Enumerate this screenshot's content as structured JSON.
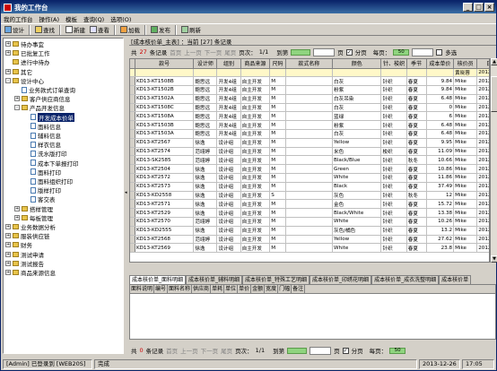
{
  "window": {
    "title": "我的工作台"
  },
  "menu": [
    "我的工作台",
    "操作(A)",
    "模板",
    "查询(Q)",
    "选项(O)"
  ],
  "toolbar": [
    "设计",
    "查找",
    "新建",
    "查看",
    "加载",
    "发布",
    "刷新"
  ],
  "tree": [
    {
      "label": "待办事宜",
      "level": 0,
      "exp": "+",
      "icon": "folder"
    },
    {
      "label": "已批复工作",
      "level": 0,
      "exp": "+",
      "icon": "folder"
    },
    {
      "label": "进行中待办",
      "level": 0,
      "exp": "",
      "icon": "folder"
    },
    {
      "label": "其它",
      "level": 0,
      "exp": "+",
      "icon": "folder"
    },
    {
      "label": "设计中心",
      "level": 0,
      "exp": "-",
      "icon": "folder"
    },
    {
      "label": "业务款式订单查询",
      "level": 1,
      "exp": "",
      "icon": "doc"
    },
    {
      "label": "客户供应商信息",
      "level": 1,
      "exp": "+",
      "icon": "folder"
    },
    {
      "label": "产品开发信息",
      "level": 1,
      "exp": "-",
      "icon": "folder"
    },
    {
      "label": "开发成本价单",
      "level": 2,
      "exp": "",
      "icon": "doc",
      "selected": true
    },
    {
      "label": "面料信息",
      "level": 2,
      "exp": "",
      "icon": "doc"
    },
    {
      "label": "辅料信息",
      "level": 2,
      "exp": "",
      "icon": "doc"
    },
    {
      "label": "样衣信息",
      "level": 2,
      "exp": "",
      "icon": "doc"
    },
    {
      "label": "洗水版打印",
      "level": 2,
      "exp": "",
      "icon": "doc"
    },
    {
      "label": "成本下单报打印",
      "level": 2,
      "exp": "",
      "icon": "doc"
    },
    {
      "label": "面料打印",
      "level": 2,
      "exp": "",
      "icon": "doc"
    },
    {
      "label": "面料组织打印",
      "level": 2,
      "exp": "",
      "icon": "doc"
    },
    {
      "label": "版样打印",
      "level": 2,
      "exp": "",
      "icon": "doc"
    },
    {
      "label": "客交表",
      "level": 2,
      "exp": "",
      "icon": "doc"
    },
    {
      "label": "搭样管理",
      "level": 1,
      "exp": "+",
      "icon": "folder"
    },
    {
      "label": "每板管理",
      "level": 1,
      "exp": "+",
      "icon": "folder"
    },
    {
      "label": "业务数据分析",
      "level": 0,
      "exp": "+",
      "icon": "folder"
    },
    {
      "label": "服装供应链",
      "level": 0,
      "exp": "+",
      "icon": "folder"
    },
    {
      "label": "财务",
      "level": 0,
      "exp": "+",
      "icon": "folder"
    },
    {
      "label": "测试申请",
      "level": 0,
      "exp": "+",
      "icon": "folder"
    },
    {
      "label": "测试报告",
      "level": 0,
      "exp": "+",
      "icon": "folder"
    },
    {
      "label": "商品来源信息",
      "level": 0,
      "exp": "+",
      "icon": "folder"
    }
  ],
  "main": {
    "header": "[成本核价单_主表] ：当前 [27] 条记录",
    "nav_top": {
      "total_label": "共",
      "total": "27",
      "unit": "条记录",
      "first": "首页",
      "prev": "上一页",
      "next": "下一页",
      "last": "尾页",
      "page_label": "页次：",
      "page": "1/1",
      "goto": "到第",
      "page_unit": "页",
      "paging": "分页",
      "per_page": "每页：",
      "per_page_value": "50",
      "multi": "多选"
    },
    "nav_bottom": {
      "total_label": "共",
      "total": "0",
      "unit": "条记录",
      "first": "首页",
      "prev": "上一页",
      "next": "下一页",
      "last": "尾页",
      "page_label": "页次：",
      "page": "1/1",
      "goto": "到第",
      "page_unit": "页",
      "paging": "分页",
      "per_page": "每页：",
      "per_page_value": "50"
    }
  },
  "grid": {
    "columns": [
      "款号",
      "设计师",
      "组别",
      "商品来源",
      "尺码",
      "款式名称",
      "颜色",
      "针、梭织",
      "季节",
      "成本单价",
      "核价员",
      "日期"
    ],
    "rows": [
      [
        "",
        "",
        "",
        "",
        "",
        "",
        "",
        "",
        "",
        "",
        "黄晓蓉",
        "2012-8-3"
      ],
      [
        "KD13-KT1508B",
        "鲍思远",
        "开发4组",
        "自主开发",
        "M",
        "",
        "白灰",
        "针织",
        "春夏",
        "9.84",
        "Mike",
        "2012-7-20"
      ],
      [
        "KD13-KT1502B",
        "鲍思远",
        "开发4组",
        "自主开发",
        "M",
        "",
        "粉紫",
        "针织",
        "春夏",
        "9.84",
        "Mike",
        "2012-7-20"
      ],
      [
        "KD13-KT1502A",
        "鲍思远",
        "开发4组",
        "自主开发",
        "M",
        "",
        "白灰吊染",
        "针织",
        "春夏",
        "6.48",
        "Mike",
        "2012-7-20"
      ],
      [
        "KD13-KT1508C",
        "鲍思远",
        "开发4组",
        "自主开发",
        "M",
        "",
        "白灰",
        "针织",
        "春夏",
        "0",
        "Mike",
        "2012-7-20"
      ],
      [
        "KD13-KT1508A",
        "鲍思远",
        "开发4组",
        "自主开发",
        "M",
        "",
        "蓝绿",
        "针织",
        "春夏",
        "6",
        "Mike",
        "2012-7-20"
      ],
      [
        "KD13-KT1503B",
        "鲍思远",
        "开发4组",
        "自主开发",
        "M",
        "",
        "粉紫",
        "针织",
        "春夏",
        "6.48",
        "Mike",
        "2012-7-20"
      ],
      [
        "KD13-KT1503A",
        "鲍思远",
        "开发4组",
        "自主开发",
        "M",
        "",
        "白灰",
        "针织",
        "春夏",
        "6.48",
        "Mike",
        "2012-7-20"
      ],
      [
        "KD13-KT2567",
        "徐逸",
        "设计组",
        "自主开发",
        "M",
        "",
        "Yellow",
        "针织",
        "春夏",
        "9.95",
        "Mike",
        "2012-7-20"
      ],
      [
        "KD13-KT2574",
        "范翊婷",
        "设计组",
        "自主开发",
        "M",
        "",
        "米色",
        "梭织",
        "春夏",
        "11.09",
        "Mike",
        "2012-7-20"
      ],
      [
        "KD13-SK2585",
        "范翊婷",
        "设计组",
        "自主开发",
        "M",
        "",
        "Black/Blue",
        "针织",
        "秋冬",
        "10.66",
        "Mike",
        "2012-7-20"
      ],
      [
        "KD13-KT2504",
        "徐逸",
        "设计组",
        "自主开发",
        "M",
        "",
        "Green",
        "针织",
        "春夏",
        "10.86",
        "Mike",
        "2012-7-20"
      ],
      [
        "KD13-KT2572",
        "徐逸",
        "设计组",
        "自主开发",
        "M",
        "",
        "White",
        "针织",
        "春夏",
        "11.86",
        "Mike",
        "2012-7-20"
      ],
      [
        "KD13-KT2573",
        "徐逸",
        "设计组",
        "自主开发",
        "M",
        "",
        "Black",
        "针织",
        "春夏",
        "37.49",
        "Mike",
        "2012-7-20"
      ],
      [
        "KD13-KD2558",
        "徐逸",
        "设计组",
        "自主开发",
        "S",
        "",
        "灰色",
        "针织",
        "秋冬",
        "12",
        "Mike",
        "2012-7-20"
      ],
      [
        "KD13-KT2571",
        "徐逸",
        "设计组",
        "自主开发",
        "M",
        "",
        "金色",
        "针织",
        "春夏",
        "15.72",
        "Mike",
        "2012-7-20"
      ],
      [
        "KD13-KT2529",
        "徐逸",
        "设计组",
        "自主开发",
        "M",
        "",
        "Black/White",
        "针织",
        "春夏",
        "13.38",
        "Mike",
        "2012-7-20"
      ],
      [
        "KD13-KT2570",
        "范翊婷",
        "设计组",
        "自主开发",
        "M",
        "",
        "White",
        "针织",
        "春夏",
        "10.26",
        "Mike",
        "2012-7-20"
      ],
      [
        "KD13-KD2555",
        "徐逸",
        "设计组",
        "自主开发",
        "M",
        "",
        "灰色/橘色",
        "针织",
        "春夏",
        "13.2",
        "Mike",
        "2012-7-20"
      ],
      [
        "KD13-KT2568",
        "范翊婷",
        "设计组",
        "自主开发",
        "M",
        "",
        "Yellow",
        "针织",
        "春夏",
        "27.62",
        "Mike",
        "2012-7-20"
      ],
      [
        "KD13-KT2569",
        "徐逸",
        "设计组",
        "自主开发",
        "M",
        "",
        "White",
        "针织",
        "春夏",
        "23.8",
        "Mike",
        "2012-7-20"
      ]
    ]
  },
  "tabs": [
    "成本核价单_面料明细",
    "成本核价单_辅料明细",
    "成本核价单_特殊工艺明细",
    "成本核价单_印绣花明细",
    "成本核价单_成衣洗整明细",
    "成本核价单"
  ],
  "subgrid": {
    "columns": [
      "面料说明",
      "编号",
      "面料名称",
      "供应商",
      "单耗",
      "单位",
      "单价",
      "金额",
      "宽度",
      "门幅",
      "备注"
    ]
  },
  "status": {
    "user": "[Admin] 已登录到 [WEB20S]",
    "state": "完成",
    "date": "2013-12-26",
    "time": "17:05"
  }
}
